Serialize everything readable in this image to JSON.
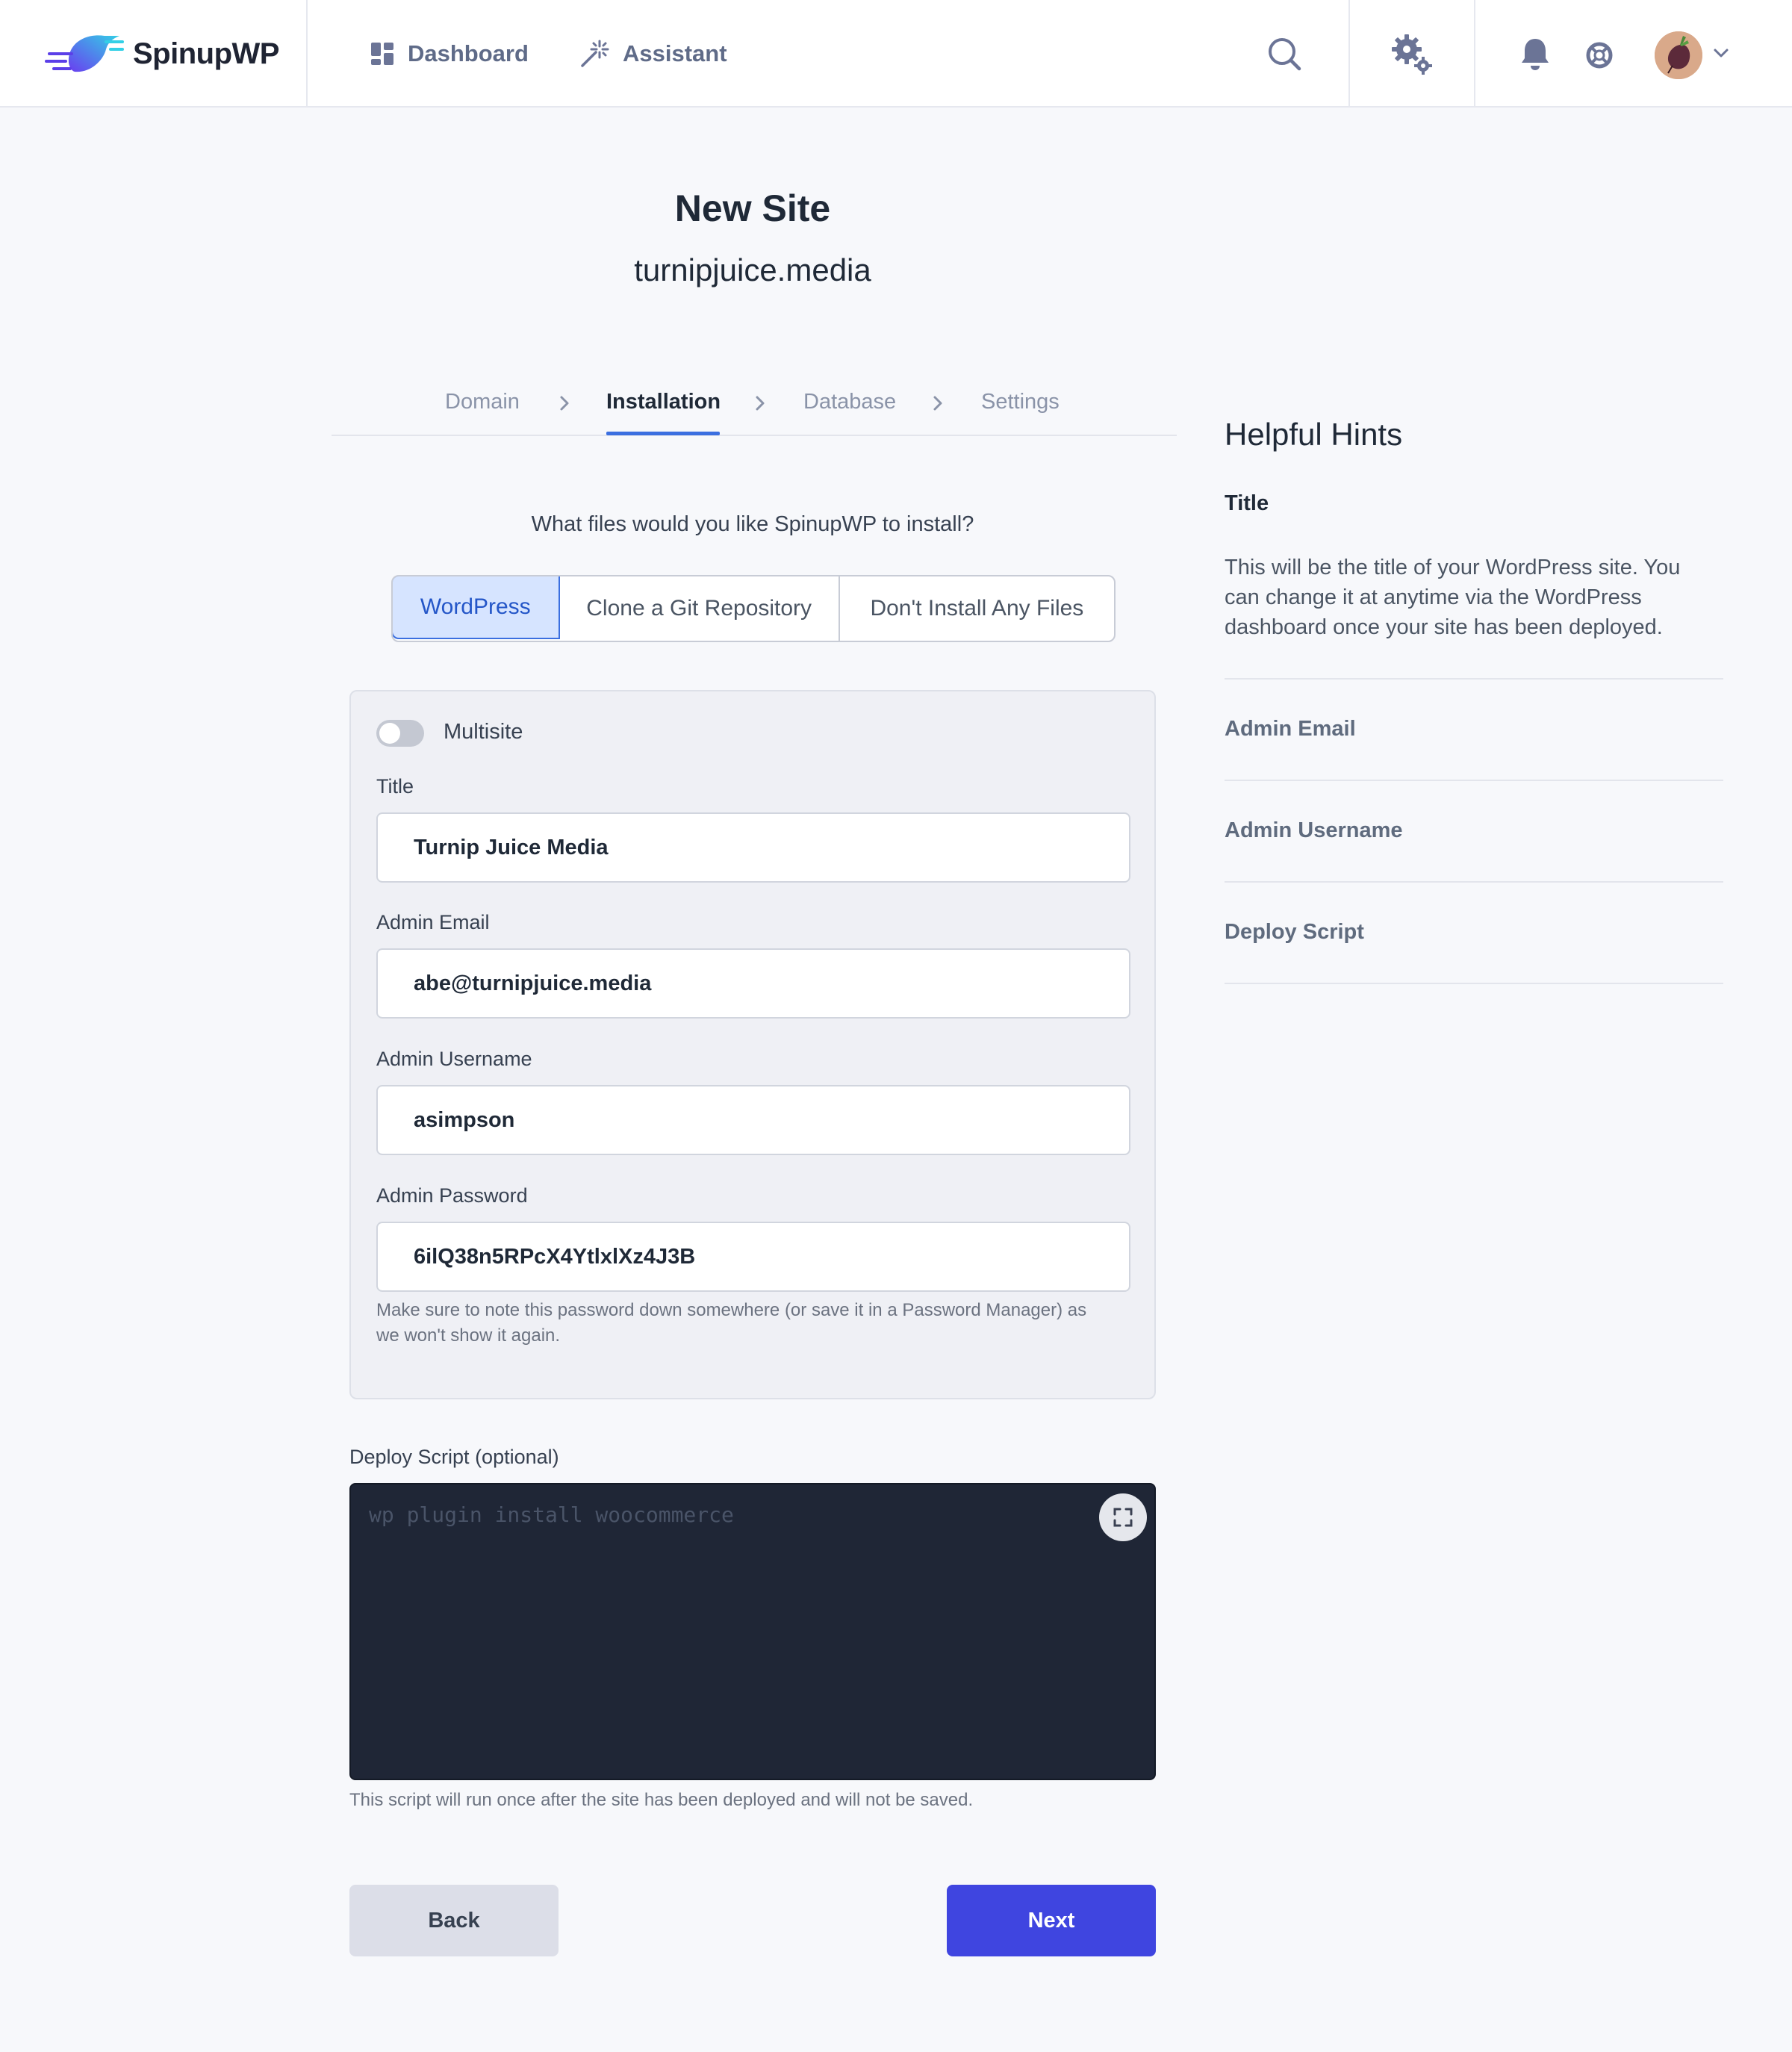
{
  "header": {
    "brand": "SpinupWP",
    "nav": [
      {
        "label": "Dashboard",
        "icon": "dashboard-icon"
      },
      {
        "label": "Assistant",
        "icon": "magic-wand-icon"
      }
    ],
    "icons": [
      "search-icon",
      "gear-icon",
      "bell-icon",
      "help-lifebuoy-icon",
      "avatar",
      "chevron-down-icon"
    ],
    "colors": {
      "nav_text": "#5f6b88",
      "icon": "#6b7496"
    }
  },
  "page": {
    "title": "New Site",
    "subtitle": "turnipjuice.media"
  },
  "steps": [
    {
      "label": "Domain",
      "active": false
    },
    {
      "label": "Installation",
      "active": true
    },
    {
      "label": "Database",
      "active": false
    },
    {
      "label": "Settings",
      "active": false
    }
  ],
  "install": {
    "question": "What files would you like SpinupWP to install?",
    "options": [
      {
        "label": "WordPress",
        "selected": true
      },
      {
        "label": "Clone a Git Repository",
        "selected": false
      },
      {
        "label": "Don't Install Any Files",
        "selected": false
      }
    ]
  },
  "form": {
    "multisite": {
      "label": "Multisite",
      "enabled": false
    },
    "title": {
      "label": "Title",
      "value": "Turnip Juice Media"
    },
    "admin_email": {
      "label": "Admin Email",
      "value": "abe@turnipjuice.media"
    },
    "admin_username": {
      "label": "Admin Username",
      "value": "asimpson"
    },
    "admin_password": {
      "label": "Admin Password",
      "value": "6ilQ38n5RPcX4YtlxlXz4J3B",
      "help_line1": "Make sure to note this password down somewhere (or save it in a Password Manager) as",
      "help_line2": "we won't show it again."
    }
  },
  "deploy_script": {
    "label": "Deploy Script (optional)",
    "placeholder": "wp plugin install woocommerce",
    "help": "This script will run once after the site has been deployed and will not be saved."
  },
  "buttons": {
    "back": "Back",
    "next": "Next",
    "colors": {
      "back_bg": "#dcdee8",
      "next_bg": "#3f45e0"
    }
  },
  "hints": {
    "title": "Helpful Hints",
    "active": {
      "title": "Title",
      "body": "This will be the title of your WordPress site. You can change it at anytime via the WordPress dashboard once your site has been deployed."
    },
    "items": [
      "Admin Email",
      "Admin Username",
      "Deploy Script"
    ]
  }
}
